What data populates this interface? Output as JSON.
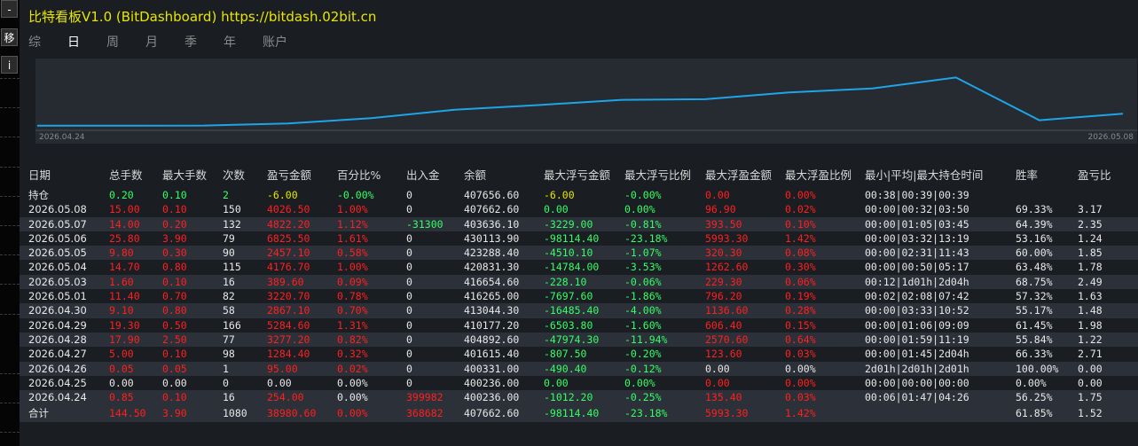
{
  "left_toolbar": {
    "minimize_label": "-",
    "move_label": "移",
    "info_label": "i"
  },
  "header": {
    "title": "比特看板V1.0 (BitDashboard)  https://bitdash.02bit.cn"
  },
  "tabs": [
    "综",
    "日",
    "周",
    "月",
    "季",
    "年",
    "账户"
  ],
  "active_tab": "日",
  "chart_data": {
    "type": "line",
    "series_color": "#1ea5e8",
    "x_start_label": "2026.04.24",
    "x_end_label": "2026.05.08",
    "x": [
      "2026.04.24",
      "2026.04.25",
      "2026.04.26",
      "2026.04.27",
      "2026.04.28",
      "2026.04.29",
      "2026.04.30",
      "2026.05.01",
      "2026.05.03",
      "2026.05.04",
      "2026.05.05",
      "2026.05.06",
      "2026.05.07",
      "2026.05.08"
    ],
    "values": [
      400236.0,
      400236.0,
      400331.0,
      401615.4,
      404892.6,
      410177.2,
      413044.3,
      416265.0,
      416654.6,
      420831.3,
      423288.4,
      430113.9,
      403636.1,
      407662.6
    ],
    "ylim": [
      399000,
      432000
    ]
  },
  "table": {
    "columns": [
      "日期",
      "总手数",
      "最大手数",
      "次数",
      "盈亏金额",
      "百分比%",
      "出入金",
      "余额",
      "最大浮亏金额",
      "最大浮亏比例",
      "最大浮盈金额",
      "最大浮盈比例",
      "最小|平均|最大持仓时间",
      "胜率",
      "盈亏比"
    ],
    "rows": [
      [
        "持仓",
        "0.20",
        "0.10",
        "2",
        "-6.00",
        "-0.00%",
        "0",
        "407656.60",
        "-6.00",
        "-0.00%",
        "0.00",
        "0.00%",
        "00:38|00:39|00:39",
        "",
        ""
      ],
      [
        "2026.05.08",
        "15.00",
        "0.10",
        "150",
        "4026.50",
        "1.00%",
        "0",
        "407662.60",
        "0.00",
        "0.00%",
        "96.90",
        "0.02%",
        "00:00|00:32|03:50",
        "69.33%",
        "3.17"
      ],
      [
        "2026.05.07",
        "14.00",
        "0.20",
        "132",
        "4822.20",
        "1.12%",
        "-31300",
        "403636.10",
        "-3229.00",
        "-0.81%",
        "393.50",
        "0.10%",
        "00:00|01:05|03:45",
        "64.39%",
        "2.35"
      ],
      [
        "2026.05.06",
        "25.80",
        "3.90",
        "79",
        "6825.50",
        "1.61%",
        "0",
        "430113.90",
        "-98114.40",
        "-23.18%",
        "5993.30",
        "1.42%",
        "00:00|03:32|13:19",
        "53.16%",
        "1.24"
      ],
      [
        "2026.05.05",
        "9.80",
        "0.30",
        "90",
        "2457.10",
        "0.58%",
        "0",
        "423288.40",
        "-4510.10",
        "-1.07%",
        "320.30",
        "0.08%",
        "00:00|02:31|11:43",
        "60.00%",
        "1.85"
      ],
      [
        "2026.05.04",
        "14.70",
        "0.80",
        "115",
        "4176.70",
        "1.00%",
        "0",
        "420831.30",
        "-14784.00",
        "-3.53%",
        "1262.60",
        "0.30%",
        "00:00|00:50|05:17",
        "63.48%",
        "1.78"
      ],
      [
        "2026.05.03",
        "1.60",
        "0.10",
        "16",
        "389.60",
        "0.09%",
        "0",
        "416654.60",
        "-228.10",
        "-0.06%",
        "229.30",
        "0.06%",
        "00:12|1d01h|2d04h",
        "68.75%",
        "2.49"
      ],
      [
        "2026.05.01",
        "11.40",
        "0.70",
        "82",
        "3220.70",
        "0.78%",
        "0",
        "416265.00",
        "-7697.60",
        "-1.86%",
        "796.20",
        "0.19%",
        "00:02|02:08|07:42",
        "57.32%",
        "1.63"
      ],
      [
        "2026.04.30",
        "9.10",
        "0.80",
        "58",
        "2867.10",
        "0.70%",
        "0",
        "413044.30",
        "-16485.40",
        "-4.00%",
        "1136.60",
        "0.28%",
        "00:00|03:33|10:52",
        "55.17%",
        "1.48"
      ],
      [
        "2026.04.29",
        "19.30",
        "0.50",
        "166",
        "5284.60",
        "1.31%",
        "0",
        "410177.20",
        "-6503.80",
        "-1.60%",
        "606.40",
        "0.15%",
        "00:00|01:06|09:09",
        "61.45%",
        "1.98"
      ],
      [
        "2026.04.28",
        "17.90",
        "2.50",
        "77",
        "3277.20",
        "0.82%",
        "0",
        "404892.60",
        "-47974.30",
        "-11.94%",
        "2570.60",
        "0.64%",
        "00:00|01:59|11:19",
        "55.84%",
        "1.22"
      ],
      [
        "2026.04.27",
        "5.00",
        "0.10",
        "98",
        "1284.40",
        "0.32%",
        "0",
        "401615.40",
        "-807.50",
        "-0.20%",
        "123.60",
        "0.03%",
        "00:00|01:45|2d04h",
        "66.33%",
        "2.71"
      ],
      [
        "2026.04.26",
        "0.05",
        "0.05",
        "1",
        "95.00",
        "0.02%",
        "0",
        "400331.00",
        "-490.40",
        "-0.12%",
        "0.00",
        "0.00%",
        "2d01h|2d01h|2d01h",
        "100.00%",
        "0.00"
      ],
      [
        "2026.04.25",
        "0.00",
        "0.00",
        "0",
        "0.00",
        "0.00%",
        "0",
        "400236.00",
        "0.00",
        "0.00%",
        "0.00",
        "0.00%",
        "00:00|00:00|00:00",
        "0.00%",
        "0.00"
      ],
      [
        "2026.04.24",
        "0.85",
        "0.10",
        "16",
        "254.00",
        "0.00%",
        "399982",
        "400236.00",
        "-1012.20",
        "-0.25%",
        "135.40",
        "0.03%",
        "00:06|01:47|04:26",
        "56.25%",
        "1.75"
      ]
    ],
    "summary": [
      "合计",
      "144.50",
      "3.90",
      "1080",
      "38980.60",
      "0.00%",
      "368682",
      "407662.60",
      "-98114.40",
      "-23.18%",
      "5993.30",
      "1.42%",
      "",
      "61.85%",
      "1.52"
    ]
  },
  "colors": {
    "header_title": "#e6e600",
    "profit": "#ff2020",
    "loss": "#33ff66",
    "neutral": "#e8e8e8",
    "deposit": "#ff2020"
  }
}
